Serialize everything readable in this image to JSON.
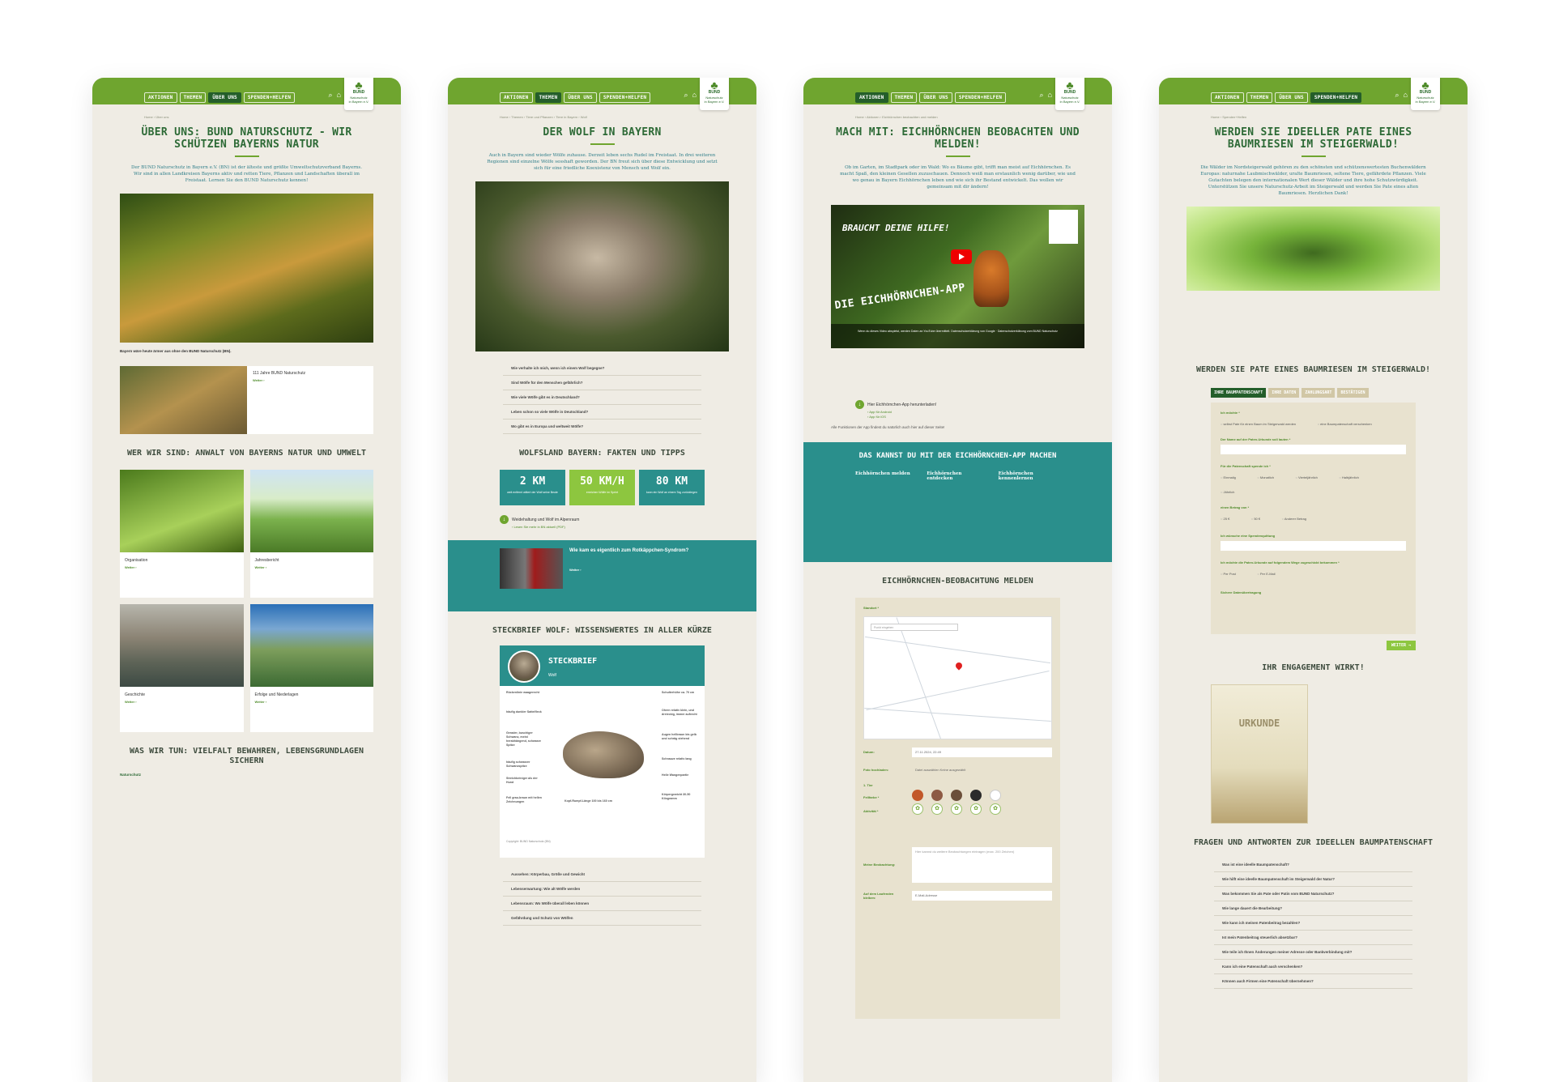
{
  "nav": {
    "items": [
      "AKTIONEN",
      "THEMEN",
      "ÜBER UNS",
      "SPENDEN+HELFEN"
    ],
    "logo_line1": "BUND",
    "logo_line2": "Naturschutz",
    "logo_line3": "in Bayern e.V."
  },
  "page1": {
    "breadcrumb": "Home  ›  Über uns",
    "title": "ÜBER UNS: BUND NATURSCHUTZ - WIR SCHÜTZEN BAYERNS NATUR",
    "lead": "Der BUND Naturschutz in Bayern e.V. (BN) ist der älteste und größte Umweltschutzverband Bayerns. Wir sind in allen Landkreisen Bayerns aktiv und retten Tiere, Pflanzen und Landschaften überall im Freistaat. Lernen Sie den BUND Naturschutz kennen!",
    "intro_bold": "Bayern wäre heute ärmer aus ohne den BUND Naturschutz (BN).",
    "card_title": "111 Jahre BUND Naturschutz",
    "more": "Weiter ›",
    "h_wer": "WER WIR SIND: ANWALT VON BAYERNS NATUR UND UMWELT",
    "grid": [
      {
        "title": "Organisation"
      },
      {
        "title": "Jahresbericht"
      },
      {
        "title": "Geschichte"
      },
      {
        "title": "Erfolge und Niederlagen"
      }
    ],
    "h_was": "WAS WIR TUN: VIELFALT BEWAHREN, LEBENSGRUNDLAGEN SICHERN",
    "sub_naturschutz": "Naturschutz"
  },
  "page2": {
    "breadcrumb": "Home  ›  Themen  ›  Tiere und Pflanzen  ›  Tiere in Bayern  ›  Wolf",
    "title": "DER WOLF IN BAYERN",
    "lead": "Auch in Bayern sind wieder Wölfe zuhause. Derzeit leben sechs Rudel im Freistaat. In drei weiteren Regionen sind einzelne Wölfe sesshaft geworden. Der BN freut sich über diese Entwicklung und setzt sich für eine friedliche Koexistenz von Mensch und Wolf ein.",
    "faq": [
      "Wie verhalte ich mich, wenn ich einem Wolf begegne?",
      "Sind Wölfe für den Menschen gefährlich?",
      "Wie viele Wölfe gibt es in Deutschland?",
      "Leben schon so viele Wölfe in Deutschland?",
      "Wo gibt es in Europa und weltweit Wölfe?"
    ],
    "h_wolfsland": "WOLFSLAND BAYERN: FAKTEN UND TIPPS",
    "stats": [
      {
        "value": "2 KM",
        "label": "weit entfernt wittert der Wolf seine Beute"
      },
      {
        "value": "50 KM/H",
        "label": "erreichen Wölfe im Sprint"
      },
      {
        "value": "80 KM",
        "label": "kann ein Wolf an einem Tag zurücklegen"
      }
    ],
    "download_title": "Weidehaltung und Wolf im Alpenraum",
    "download_link": "› Lesen Sie mehr in BN aktuell (PDF)",
    "story_title": "Wie kam es eigentlich zum Rotkäppchen-Syndrom?",
    "story_more": "Weiter ›",
    "h_steck": "STECKBRIEF WOLF: WISSENSWERTES IN ALLER KÜRZE",
    "steck_title": "STECKBRIEF",
    "steck_sub": "Wolf",
    "steck_labels": [
      "Rückenlinie waagerecht",
      "häufig dunkler Sattelfleck",
      "Gerader, buschiger Schwanz, meist herabhängend, schwarze Spitze",
      "häufig schwarzer Schwanzspitze",
      "Streichbeiniger als der Hund",
      "Fell grau-braun mit hellen Zeichnungen",
      "Schulterhöhe ca. 70 cm",
      "Ohren relativ klein, und dreieckig, immer aufrecht",
      "Augen hellbraun bis gelb und schräg stehend",
      "Schnauze relativ lang",
      "Helle Wangenpartie",
      "Körpergewicht 30-50 Kilogramm",
      "Kopf-Rumpf-Länge 100 bis 160 cm"
    ],
    "copyright": "Copyright: BUND Naturschutz (BN)",
    "faq2": [
      "Aussehen: Körperbau, Größe und Gewicht",
      "Lebenserwartung: Wie alt Wölfe werden",
      "Lebensraum: Wo Wölfe überall leben können",
      "Gefährdung und Schutz von Wölfen"
    ]
  },
  "page3": {
    "breadcrumb": "Home  ›  Aktionen  ›  Eichhörnchen beobachten und melden",
    "title": "MACH MIT: EICHHÖRNCHEN BEOBACHTEN UND MELDEN!",
    "lead": "Ob im Garten, im Stadtpark oder im Wald: Wo es Bäume gibt, trifft man meist auf Eichhörnchen. Es macht Spaß, den kleinen Gesellen zuzuschauen. Dennoch weiß man erstaunlich wenig darüber, wie und wo genau in Bayern Eichhörnchen leben und wie sich ihr Bestand entwickelt. Das wollen wir gemeinsam mit dir ändern!",
    "video_title": "BRAUCHT DEINE HILFE!",
    "video_app": "DIE EICHHÖRNCHEN-APP",
    "video_note": "Wenn du dieses Video abspielst, werden Daten an YouTube übermittelt. Datenschutzerklärung von Google · Datenschutzerklärung vom BUND Naturschutz",
    "app_download": "Hier Eichhörnchen-App herunterladen!",
    "app_android": "› App für Android",
    "app_ios": "› App für iOS",
    "all_functions": "Alle Funktionen der App findest du natürlich auch hier auf dieser Seite!",
    "band_title": "DAS KANNST DU MIT DER EICHHÖRNCHEN-APP MACHEN",
    "band_cols": [
      {
        "title": "Eichhörnchen melden"
      },
      {
        "title": "Eichhörnchen entdecken"
      },
      {
        "title": "Eichhörnchen kennenlernen"
      }
    ],
    "h_melden": "EICHHÖRNCHEN-BEOBACHTUNG MELDEN",
    "form_location": "Standort *",
    "map_search": "Punkt eingeben",
    "form_date": "Datum:",
    "date_value": "27.11.2024, 22:49",
    "form_photo": "Foto hochladen:",
    "photo_value": "Datei auswählen   Keine ausgewählt",
    "form_count": "1. Tier",
    "form_color": "Fellfarbe *",
    "color_labels": [
      "Rot",
      "Rot-Grau",
      "Braun-Grau",
      "Dunkelbraun oder Schwarz",
      "Nicht erkannt / unsicher"
    ],
    "form_activity": "Aktivität *",
    "form_notes": "Meine Beobachtung:",
    "notes_placeholder": "Hier kannst du weitere Beobachtungen eintragen (max. 200 Zeichen)",
    "form_email": "Auf dem Laufenden bleiben:",
    "email_placeholder": "E-Mail-Adresse"
  },
  "page4": {
    "breadcrumb": "Home  ›  Spenden+Helfen",
    "title": "WERDEN SIE IDEELLER PATE EINES BAUMRIESEN IM STEIGERWALD!",
    "lead": "Die Wälder im Nordsteigerwald gehören zu den schönsten und schützenswertesten Buchenwäldern Europas: naturnahe Laubmischwälder, uralte Baumriesen, seltene Tiere, gefährdete Pflanzen. Viele Gutachten belegen den internationalen Wert dieser Wälder und ihre hohe Schutzwürdigkeit. Unterstützen Sie unsere Naturschutz-Arbeit im Steigerwald und werden Sie Pate eines alten Baumriesen. Herzlichen Dank!",
    "h_form": "WERDEN SIE PATE EINES BAUMRIESEN IM STEIGERWALD!",
    "tabs": [
      "IHRE BAUMPATENSCHAFT",
      "IHRE DATEN",
      "ZAHLUNGSART",
      "BESTÄTIGEN"
    ],
    "q_whoami": "Ich möchte *",
    "opt_self": "selbst Pate für einen Baum im Steigerwald werden",
    "opt_gift": "eine Baumpatenschaft verschenken",
    "q_name": "Der Name auf der Paten-Urkunde soll lauten *",
    "q_period": "Für die Patenschaft spende ich *",
    "periods": [
      "Einmalig",
      "Monatlich",
      "Vierteljährlich",
      "Halbjährlich",
      "Jährlich"
    ],
    "q_amount": "einen Betrag von *",
    "amounts": [
      "25 €",
      "50 €",
      "Anderer Betrag"
    ],
    "q_receipt": "Ich wünsche eine Spendenquittung",
    "q_cert": "Ich möchte die Paten-Urkunde auf folgendem Wege zugeschickt bekommen *",
    "cert_opts": [
      "Per Post",
      "Per E-Mail"
    ],
    "secure": "Sichere Datenübertragung",
    "next": "WEITER →",
    "h_engagement": "IHR ENGAGEMENT WIRKT!",
    "cert_word": "URKUNDE",
    "h_faq": "FRAGEN UND ANTWORTEN ZUR IDEELLEN BAUMPATENSCHAFT",
    "faq": [
      "Was ist eine ideelle Baumpatenschaft?",
      "Wie hilft eine ideelle Baumpatenschaft im Steigerwald der Natur?",
      "Was bekommen Sie als Pate oder Patin vom BUND Naturschutz?",
      "Wie lange dauert die Bearbeitung?",
      "Wie kann ich meinen Patenbeitrag bezahlen?",
      "Ist mein Patenbeitrag steuerlich absetzbar?",
      "Wie teile ich Ihnen Änderungen meiner Adresse oder Bankverbindung mit?",
      "Kann ich eine Patenschaft auch verschenken?",
      "Können auch Firmen eine Patenschaft übernehmen?"
    ]
  },
  "colors": {
    "green": "#6fa52f",
    "dark_green": "#245e2a",
    "teal": "#2a8f8c",
    "lime": "#8dc63f",
    "beige": "#efece4"
  }
}
